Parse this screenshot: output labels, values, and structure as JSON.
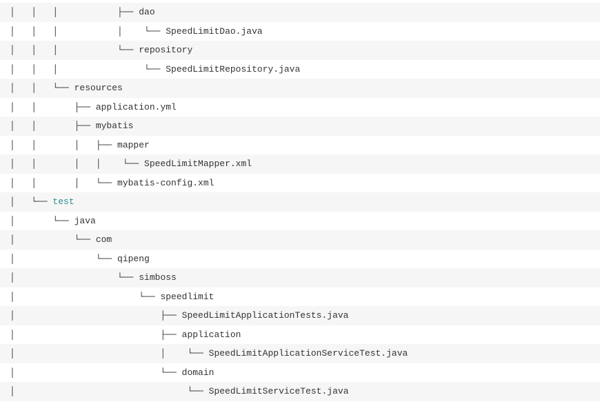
{
  "tree": {
    "lines": [
      {
        "prefix": "│   │   │           ├── ",
        "text": "dao",
        "keyword": false
      },
      {
        "prefix": "│   │   │           │    └── ",
        "text": "SpeedLimitDao.java",
        "keyword": false
      },
      {
        "prefix": "│   │   │           └── ",
        "text": "repository",
        "keyword": false
      },
      {
        "prefix": "│   │   │                └── ",
        "text": "SpeedLimitRepository.java",
        "keyword": false
      },
      {
        "prefix": "│   │   └── ",
        "text": "resources",
        "keyword": false
      },
      {
        "prefix": "│   │       ├── ",
        "text": "application.yml",
        "keyword": false
      },
      {
        "prefix": "│   │       ├── ",
        "text": "mybatis",
        "keyword": false
      },
      {
        "prefix": "│   │       │   ├── ",
        "text": "mapper",
        "keyword": false
      },
      {
        "prefix": "│   │       │   │    └── ",
        "text": "SpeedLimitMapper.xml",
        "keyword": false
      },
      {
        "prefix": "│   │       │   └── ",
        "text": "mybatis-config.xml",
        "keyword": false
      },
      {
        "prefix": "│   └── ",
        "text": "test",
        "keyword": true
      },
      {
        "prefix": "│       └── ",
        "text": "java",
        "keyword": false
      },
      {
        "prefix": "│           └── ",
        "text": "com",
        "keyword": false
      },
      {
        "prefix": "│               └── ",
        "text": "qipeng",
        "keyword": false
      },
      {
        "prefix": "│                   └── ",
        "text": "simboss",
        "keyword": false
      },
      {
        "prefix": "│                       └── ",
        "text": "speedlimit",
        "keyword": false
      },
      {
        "prefix": "│                           ├── ",
        "text": "SpeedLimitApplicationTests.java",
        "keyword": false
      },
      {
        "prefix": "│                           ├── ",
        "text": "application",
        "keyword": false
      },
      {
        "prefix": "│                           │    └── ",
        "text": "SpeedLimitApplicationServiceTest.java",
        "keyword": false
      },
      {
        "prefix": "│                           └── ",
        "text": "domain",
        "keyword": false
      },
      {
        "prefix": "│                                └── ",
        "text": "SpeedLimitServiceTest.java",
        "keyword": false
      }
    ]
  }
}
